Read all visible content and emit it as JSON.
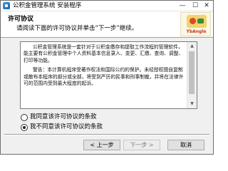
{
  "window": {
    "title": "公积金管理系统 安装程序",
    "minimize_glyph": "—",
    "maximize_glyph": "☐",
    "close_glyph": "✕"
  },
  "header": {
    "title": "许可协议",
    "subtitle": "请阅读下面的许可协议并单击“下一步”继续。",
    "logo_text": "YbAngle"
  },
  "license": {
    "paragraphs": [
      "公积金管理系统是一套针对于公积金缴存和提取工作流程的管理软件，能主要有公积金管理中个人资料基本信息录入、变更、汇缴、查询、调整、打印等功能。",
      "警告：本计算机程序受著作权法和国际公约的保护。未经授权擅自复制或散布本程序的部分或全部，将受到严厉的民事和刑事制裁，并将在法律许可的范围内受到最大程度的起诉。"
    ],
    "scroll_up_glyph": "▲",
    "scroll_down_glyph": "▼"
  },
  "options": {
    "accept_label": "我同意该许可协议的条款",
    "decline_label": "我不同意该许可协议的条款",
    "selected": "decline"
  },
  "buttons": {
    "back_label": "< 上一步",
    "next_label": "下一步 >",
    "cancel_label": "取消"
  },
  "colors": {
    "window_bg": "#f0f0f0",
    "header_bg": "#ffffff",
    "button_bg": "#e1e1e1",
    "disabled_text": "#808080"
  }
}
